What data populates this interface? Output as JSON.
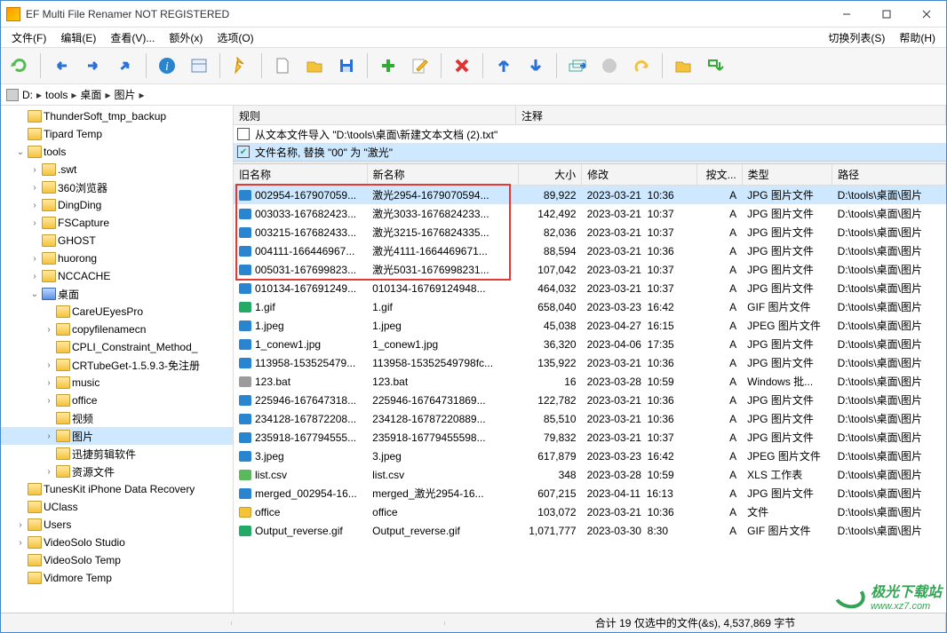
{
  "window": {
    "title": "EF Multi File Renamer NOT REGISTERED"
  },
  "menu": {
    "file": "文件(F)",
    "edit": "编辑(E)",
    "view": "查看(V)...",
    "extra": "额外(x)",
    "options": "选项(O)",
    "switchlist": "切换列表(S)",
    "help": "帮助(H)"
  },
  "path": {
    "drive": "D:",
    "p1": "tools",
    "p2": "桌面",
    "p3": "图片"
  },
  "rules": {
    "header_rule": "规则",
    "header_note": "注释",
    "row1": "从文本文件导入  \"D:\\tools\\桌面\\新建文本文档 (2).txt\"",
    "row2": "文件名称, 替换 \"00\" 为 \"激光\""
  },
  "columns": {
    "old": "旧名称",
    "new": "新名称",
    "size": "大小",
    "mod": "修改",
    "attr": "按文...",
    "type": "类型",
    "pathcol": "路径"
  },
  "common_path": "D:\\tools\\桌面\\图片",
  "files": [
    {
      "ic": "jpg",
      "old": "002954-167907059...",
      "new": "激光2954-1679070594...",
      "size": "89,922",
      "date": "2023-03-21",
      "time": "10:36",
      "attr": "A",
      "type": "JPG 图片文件",
      "sel": true
    },
    {
      "ic": "jpg",
      "old": "003033-167682423...",
      "new": "激光3033-1676824233...",
      "size": "142,492",
      "date": "2023-03-21",
      "time": "10:37",
      "attr": "A",
      "type": "JPG 图片文件"
    },
    {
      "ic": "jpg",
      "old": "003215-167682433...",
      "new": "激光3215-1676824335...",
      "size": "82,036",
      "date": "2023-03-21",
      "time": "10:37",
      "attr": "A",
      "type": "JPG 图片文件"
    },
    {
      "ic": "jpg",
      "old": "004111-166446967...",
      "new": "激光4111-1664469671...",
      "size": "88,594",
      "date": "2023-03-21",
      "time": "10:36",
      "attr": "A",
      "type": "JPG 图片文件"
    },
    {
      "ic": "jpg",
      "old": "005031-167699823...",
      "new": "激光5031-1676998231...",
      "size": "107,042",
      "date": "2023-03-21",
      "time": "10:37",
      "attr": "A",
      "type": "JPG 图片文件"
    },
    {
      "ic": "jpg",
      "old": "010134-167691249...",
      "new": "010134-16769124948...",
      "size": "464,032",
      "date": "2023-03-21",
      "time": "10:37",
      "attr": "A",
      "type": "JPG 图片文件"
    },
    {
      "ic": "gif",
      "old": "1.gif",
      "new": "1.gif",
      "size": "658,040",
      "date": "2023-03-23",
      "time": "16:42",
      "attr": "A",
      "type": "GIF 图片文件"
    },
    {
      "ic": "jpeg",
      "old": "1.jpeg",
      "new": "1.jpeg",
      "size": "45,038",
      "date": "2023-04-27",
      "time": "16:15",
      "attr": "A",
      "type": "JPEG 图片文件"
    },
    {
      "ic": "jpg",
      "old": "1_conew1.jpg",
      "new": "1_conew1.jpg",
      "size": "36,320",
      "date": "2023-04-06",
      "time": "17:35",
      "attr": "A",
      "type": "JPG 图片文件"
    },
    {
      "ic": "jpg",
      "old": "113958-153525479...",
      "new": "113958-15352549798fc...",
      "size": "135,922",
      "date": "2023-03-21",
      "time": "10:36",
      "attr": "A",
      "type": "JPG 图片文件"
    },
    {
      "ic": "bat",
      "old": "123.bat",
      "new": "123.bat",
      "size": "16",
      "date": "2023-03-28",
      "time": "10:59",
      "attr": "A",
      "type": "Windows 批..."
    },
    {
      "ic": "jpg",
      "old": "225946-167647318...",
      "new": "225946-16764731869...",
      "size": "122,782",
      "date": "2023-03-21",
      "time": "10:36",
      "attr": "A",
      "type": "JPG 图片文件"
    },
    {
      "ic": "jpg",
      "old": "234128-167872208...",
      "new": "234128-16787220889...",
      "size": "85,510",
      "date": "2023-03-21",
      "time": "10:36",
      "attr": "A",
      "type": "JPG 图片文件"
    },
    {
      "ic": "jpg",
      "old": "235918-167794555...",
      "new": "235918-16779455598...",
      "size": "79,832",
      "date": "2023-03-21",
      "time": "10:37",
      "attr": "A",
      "type": "JPG 图片文件"
    },
    {
      "ic": "jpeg",
      "old": "3.jpeg",
      "new": "3.jpeg",
      "size": "617,879",
      "date": "2023-03-23",
      "time": "16:42",
      "attr": "A",
      "type": "JPEG 图片文件"
    },
    {
      "ic": "csv",
      "old": "list.csv",
      "new": "list.csv",
      "size": "348",
      "date": "2023-03-28",
      "time": "10:59",
      "attr": "A",
      "type": "XLS 工作表"
    },
    {
      "ic": "jpg",
      "old": "merged_002954-16...",
      "new": "merged_激光2954-16...",
      "size": "607,215",
      "date": "2023-04-11",
      "time": "16:13",
      "attr": "A",
      "type": "JPG 图片文件"
    },
    {
      "ic": "dir",
      "old": "office",
      "new": "office",
      "size": "103,072",
      "date": "2023-03-21",
      "time": "10:36",
      "attr": "A",
      "type": "文件"
    },
    {
      "ic": "gif",
      "old": "Output_reverse.gif",
      "new": "Output_reverse.gif",
      "size": "1,071,777",
      "date": "2023-03-30",
      "time": "8:30",
      "attr": "A",
      "type": "GIF 图片文件"
    }
  ],
  "tree": [
    {
      "d": 1,
      "exp": "",
      "label": "ThunderSoft_tmp_backup"
    },
    {
      "d": 1,
      "exp": "",
      "label": "Tipard Temp"
    },
    {
      "d": 1,
      "exp": "v",
      "label": "tools"
    },
    {
      "d": 2,
      "exp": ">",
      "label": ".swt"
    },
    {
      "d": 2,
      "exp": ">",
      "label": "360浏览器"
    },
    {
      "d": 2,
      "exp": ">",
      "label": "DingDing"
    },
    {
      "d": 2,
      "exp": ">",
      "label": "FSCapture"
    },
    {
      "d": 2,
      "exp": "",
      "label": "GHOST"
    },
    {
      "d": 2,
      "exp": ">",
      "label": "huorong"
    },
    {
      "d": 2,
      "exp": ">",
      "label": "NCCACHE"
    },
    {
      "d": 2,
      "exp": "v",
      "label": "桌面",
      "blue": true
    },
    {
      "d": 3,
      "exp": "",
      "label": "CareUEyesPro"
    },
    {
      "d": 3,
      "exp": ">",
      "label": "copyfilenamecn"
    },
    {
      "d": 3,
      "exp": "",
      "label": "CPLI_Constraint_Method_"
    },
    {
      "d": 3,
      "exp": ">",
      "label": "CRTubeGet-1.5.9.3-免注册"
    },
    {
      "d": 3,
      "exp": ">",
      "label": "music"
    },
    {
      "d": 3,
      "exp": ">",
      "label": "office"
    },
    {
      "d": 3,
      "exp": "",
      "label": "视频"
    },
    {
      "d": 3,
      "exp": ">",
      "label": "图片",
      "sel": true
    },
    {
      "d": 3,
      "exp": "",
      "label": "迅捷剪辑软件"
    },
    {
      "d": 3,
      "exp": ">",
      "label": "资源文件"
    },
    {
      "d": 1,
      "exp": "",
      "label": "TunesKit iPhone Data Recovery"
    },
    {
      "d": 1,
      "exp": "",
      "label": "UClass"
    },
    {
      "d": 1,
      "exp": ">",
      "label": "Users"
    },
    {
      "d": 1,
      "exp": ">",
      "label": "VideoSolo Studio"
    },
    {
      "d": 1,
      "exp": "",
      "label": "VideoSolo Temp"
    },
    {
      "d": 1,
      "exp": "",
      "label": "Vidmore Temp"
    }
  ],
  "statusbar": "合计 19 仅选中的文件(&s), 4,537,869 字节",
  "watermark": {
    "brand": "极光下载站",
    "url": "www.xz7.com"
  }
}
